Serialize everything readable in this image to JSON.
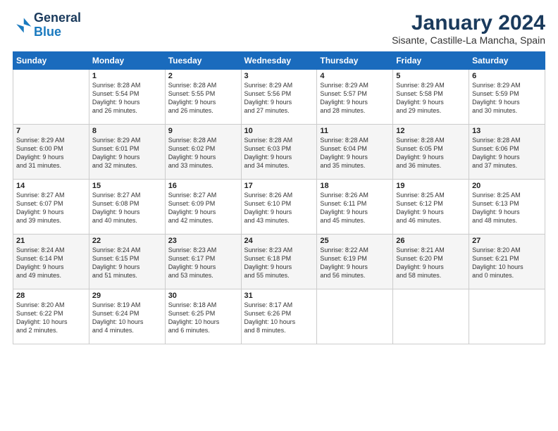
{
  "header": {
    "logo_line1": "General",
    "logo_line2": "Blue",
    "main_title": "January 2024",
    "subtitle": "Sisante, Castille-La Mancha, Spain"
  },
  "calendar": {
    "weekdays": [
      "Sunday",
      "Monday",
      "Tuesday",
      "Wednesday",
      "Thursday",
      "Friday",
      "Saturday"
    ],
    "weeks": [
      [
        {
          "num": "",
          "info": ""
        },
        {
          "num": "1",
          "info": "Sunrise: 8:28 AM\nSunset: 5:54 PM\nDaylight: 9 hours\nand 26 minutes."
        },
        {
          "num": "2",
          "info": "Sunrise: 8:28 AM\nSunset: 5:55 PM\nDaylight: 9 hours\nand 26 minutes."
        },
        {
          "num": "3",
          "info": "Sunrise: 8:29 AM\nSunset: 5:56 PM\nDaylight: 9 hours\nand 27 minutes."
        },
        {
          "num": "4",
          "info": "Sunrise: 8:29 AM\nSunset: 5:57 PM\nDaylight: 9 hours\nand 28 minutes."
        },
        {
          "num": "5",
          "info": "Sunrise: 8:29 AM\nSunset: 5:58 PM\nDaylight: 9 hours\nand 29 minutes."
        },
        {
          "num": "6",
          "info": "Sunrise: 8:29 AM\nSunset: 5:59 PM\nDaylight: 9 hours\nand 30 minutes."
        }
      ],
      [
        {
          "num": "7",
          "info": "Sunrise: 8:29 AM\nSunset: 6:00 PM\nDaylight: 9 hours\nand 31 minutes."
        },
        {
          "num": "8",
          "info": "Sunrise: 8:29 AM\nSunset: 6:01 PM\nDaylight: 9 hours\nand 32 minutes."
        },
        {
          "num": "9",
          "info": "Sunrise: 8:28 AM\nSunset: 6:02 PM\nDaylight: 9 hours\nand 33 minutes."
        },
        {
          "num": "10",
          "info": "Sunrise: 8:28 AM\nSunset: 6:03 PM\nDaylight: 9 hours\nand 34 minutes."
        },
        {
          "num": "11",
          "info": "Sunrise: 8:28 AM\nSunset: 6:04 PM\nDaylight: 9 hours\nand 35 minutes."
        },
        {
          "num": "12",
          "info": "Sunrise: 8:28 AM\nSunset: 6:05 PM\nDaylight: 9 hours\nand 36 minutes."
        },
        {
          "num": "13",
          "info": "Sunrise: 8:28 AM\nSunset: 6:06 PM\nDaylight: 9 hours\nand 37 minutes."
        }
      ],
      [
        {
          "num": "14",
          "info": "Sunrise: 8:27 AM\nSunset: 6:07 PM\nDaylight: 9 hours\nand 39 minutes."
        },
        {
          "num": "15",
          "info": "Sunrise: 8:27 AM\nSunset: 6:08 PM\nDaylight: 9 hours\nand 40 minutes."
        },
        {
          "num": "16",
          "info": "Sunrise: 8:27 AM\nSunset: 6:09 PM\nDaylight: 9 hours\nand 42 minutes."
        },
        {
          "num": "17",
          "info": "Sunrise: 8:26 AM\nSunset: 6:10 PM\nDaylight: 9 hours\nand 43 minutes."
        },
        {
          "num": "18",
          "info": "Sunrise: 8:26 AM\nSunset: 6:11 PM\nDaylight: 9 hours\nand 45 minutes."
        },
        {
          "num": "19",
          "info": "Sunrise: 8:25 AM\nSunset: 6:12 PM\nDaylight: 9 hours\nand 46 minutes."
        },
        {
          "num": "20",
          "info": "Sunrise: 8:25 AM\nSunset: 6:13 PM\nDaylight: 9 hours\nand 48 minutes."
        }
      ],
      [
        {
          "num": "21",
          "info": "Sunrise: 8:24 AM\nSunset: 6:14 PM\nDaylight: 9 hours\nand 49 minutes."
        },
        {
          "num": "22",
          "info": "Sunrise: 8:24 AM\nSunset: 6:15 PM\nDaylight: 9 hours\nand 51 minutes."
        },
        {
          "num": "23",
          "info": "Sunrise: 8:23 AM\nSunset: 6:17 PM\nDaylight: 9 hours\nand 53 minutes."
        },
        {
          "num": "24",
          "info": "Sunrise: 8:23 AM\nSunset: 6:18 PM\nDaylight: 9 hours\nand 55 minutes."
        },
        {
          "num": "25",
          "info": "Sunrise: 8:22 AM\nSunset: 6:19 PM\nDaylight: 9 hours\nand 56 minutes."
        },
        {
          "num": "26",
          "info": "Sunrise: 8:21 AM\nSunset: 6:20 PM\nDaylight: 9 hours\nand 58 minutes."
        },
        {
          "num": "27",
          "info": "Sunrise: 8:20 AM\nSunset: 6:21 PM\nDaylight: 10 hours\nand 0 minutes."
        }
      ],
      [
        {
          "num": "28",
          "info": "Sunrise: 8:20 AM\nSunset: 6:22 PM\nDaylight: 10 hours\nand 2 minutes."
        },
        {
          "num": "29",
          "info": "Sunrise: 8:19 AM\nSunset: 6:24 PM\nDaylight: 10 hours\nand 4 minutes."
        },
        {
          "num": "30",
          "info": "Sunrise: 8:18 AM\nSunset: 6:25 PM\nDaylight: 10 hours\nand 6 minutes."
        },
        {
          "num": "31",
          "info": "Sunrise: 8:17 AM\nSunset: 6:26 PM\nDaylight: 10 hours\nand 8 minutes."
        },
        {
          "num": "",
          "info": ""
        },
        {
          "num": "",
          "info": ""
        },
        {
          "num": "",
          "info": ""
        }
      ]
    ]
  }
}
